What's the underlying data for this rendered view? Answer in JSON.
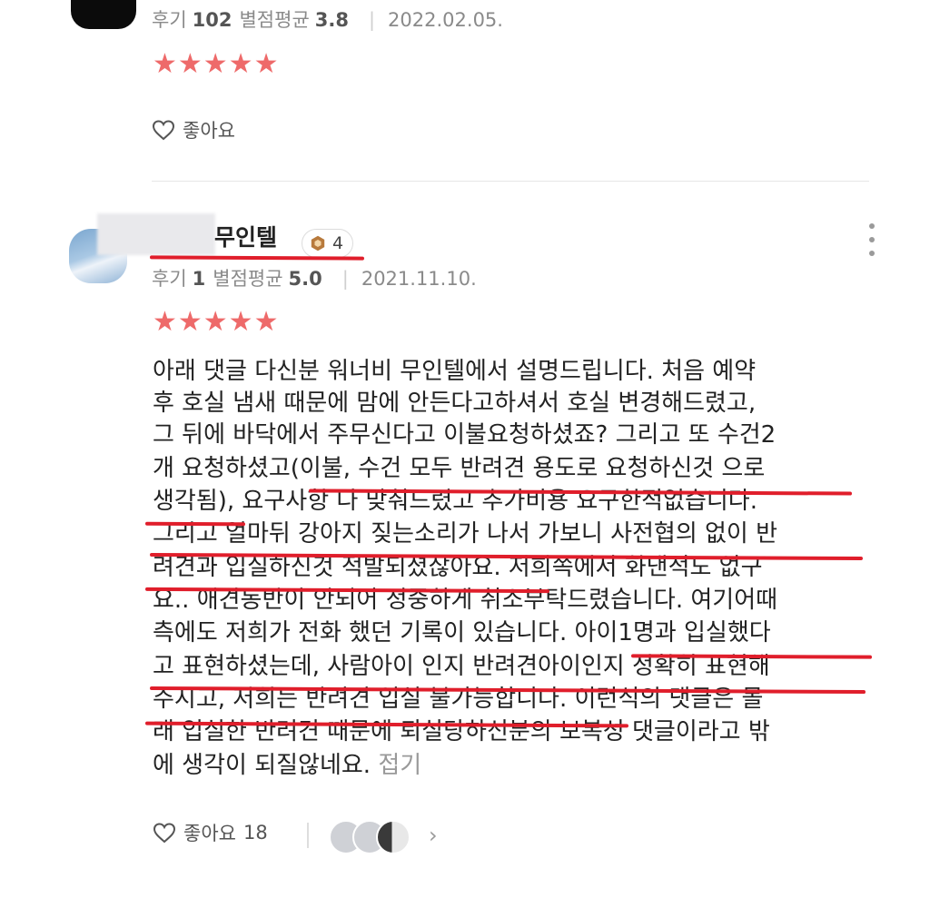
{
  "review_top": {
    "reviews_label": "후기",
    "reviews_count": "102",
    "avg_label": "별점평균",
    "avg_value": "3.8",
    "date": "2022.02.05.",
    "stars": "★★★★★",
    "like_label": "좋아요"
  },
  "review_main": {
    "author_suffix": "무인텔",
    "badge_level": "4",
    "reviews_label": "후기",
    "reviews_count": "1",
    "avg_label": "별점평균",
    "avg_value": "5.0",
    "date": "2021.11.10.",
    "stars": "★★★★★",
    "lines": [
      "아래 댓글 다신분 워너비 무인텔에서 설명드립니다.  처음 예약",
      "후 호실 냄새 때문에 맘에 안든다고하셔서  호실 변경해드렸고,",
      "그 뒤에 바닥에서 주무신다고 이불요청하셨죠? 그리고 또  수건2",
      "개 요청하셨고(이불, 수건 모두 반려견 용도로 요청하신것 으로",
      "생각됨), 요구사항 다 맞춰드렸고 추가비용 요구한적없습니다.",
      "그리고 얼마뒤 강아지 짖는소리가 나서 가보니 사전협의 없이 반",
      "려견과 입실하신것 적발되셨잖아요. 저희쪽에서 화낸적도 없구",
      "요.. 애견동반이 안되어 정중하게 취소부탁드렸습니다. 여기어때",
      "측에도 저희가 전화 했던 기록이 있습니다.   아이1명과 입실했다",
      "고 표현하셨는데, 사람아이 인지 반려견아이인지 정확히 표현해",
      "주시고, 저희는 반려견 입실 불가능합니다.  이런식의 댓글은 몰",
      "래 입실한 반려견 때문에 퇴실당하신분의 보복성 댓글이라고 밖",
      "에 생각이 되질않네요."
    ],
    "fold_label": "접기",
    "like_label": "좋아요",
    "like_count": "18"
  },
  "colors": {
    "star": "#ee6a6a",
    "underline": "#e01e2b",
    "meta_text": "#8a8a8a"
  },
  "icons": [
    "heart-outline-icon",
    "level-badge-icon",
    "more-vertical-icon",
    "chevron-right-icon"
  ]
}
